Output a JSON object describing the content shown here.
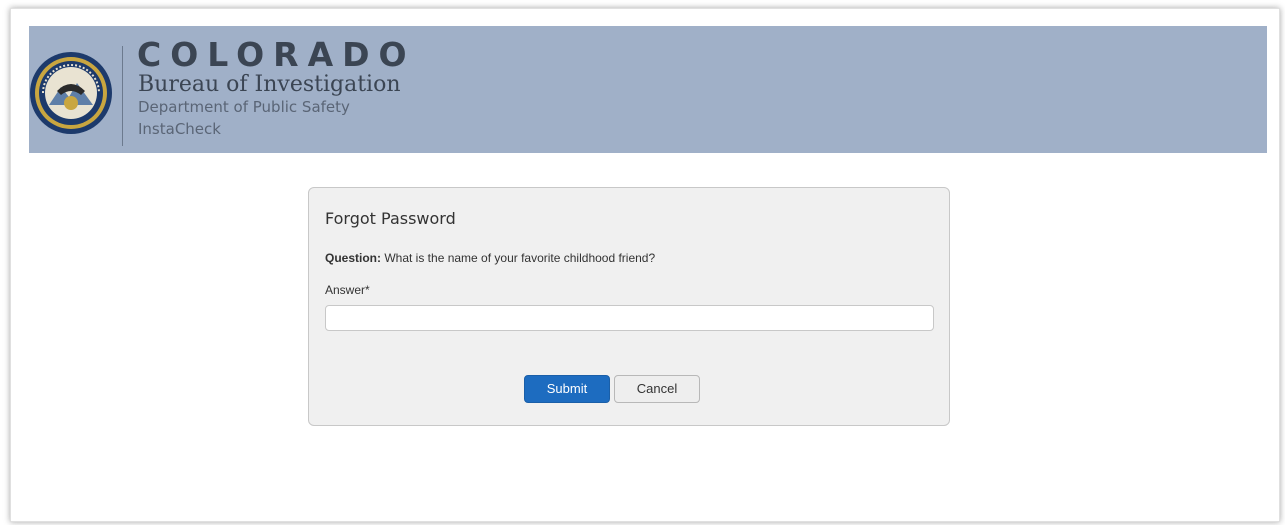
{
  "header": {
    "title": "COLORADO",
    "subtitle": "Bureau of Investigation",
    "department": "Department of Public Safety",
    "app_name": "InstaCheck",
    "seal_icon": "cbi-seal-icon",
    "background_color": "#a0b0c8"
  },
  "form": {
    "title": "Forgot Password",
    "question_label": "Question:",
    "question_text": "What is the name of your favorite childhood friend?",
    "answer_label": "Answer*",
    "answer_value": "",
    "answer_placeholder": "",
    "submit_label": "Submit",
    "cancel_label": "Cancel",
    "submit_color": "#1d6cc0"
  }
}
